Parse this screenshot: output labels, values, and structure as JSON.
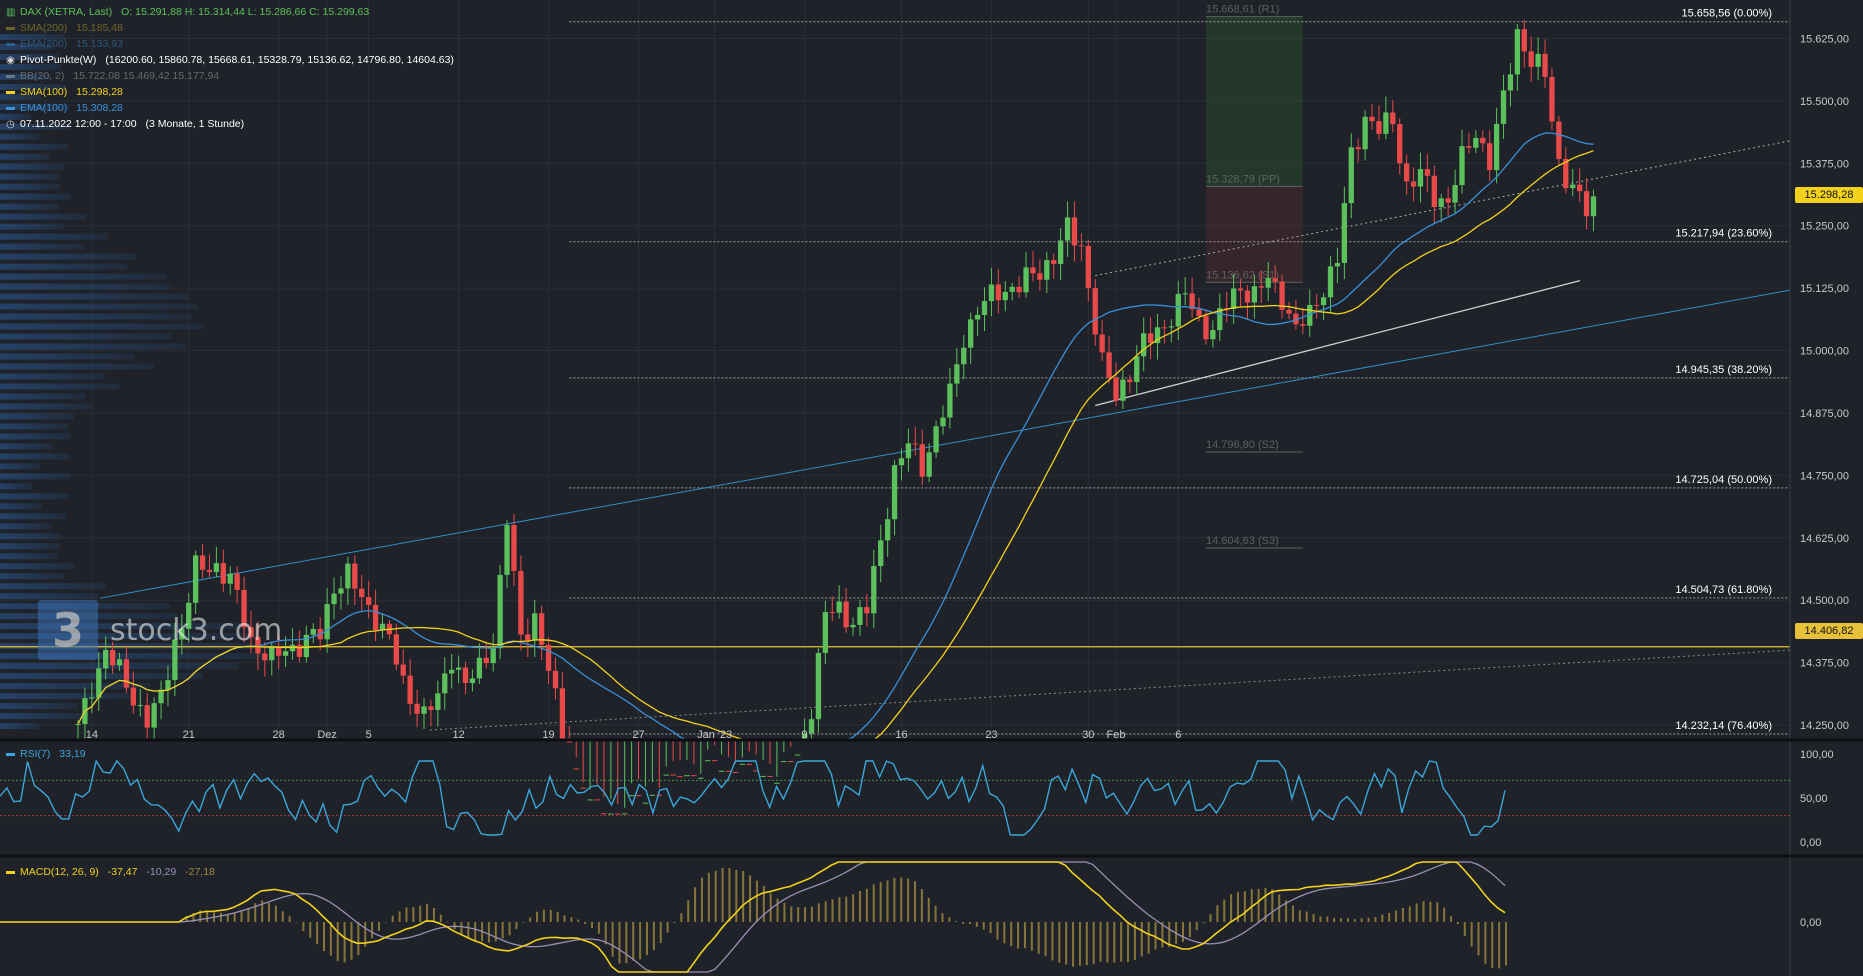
{
  "header": {
    "instrument": "DAX (XETRA, Last)",
    "ohlc": "O: 15.291,88   H: 15.314,44   L: 15.286,66   C: 15.299,63"
  },
  "legend": [
    {
      "label": "SMA(200)",
      "value": "15.185,48",
      "color": "#c9b22a",
      "dim": true,
      "kind": "line"
    },
    {
      "label": "EMA(200)",
      "value": "15.133,93",
      "color": "#3a8fd9",
      "dim": true,
      "kind": "line"
    },
    {
      "label": "Pivot-Punkte(W)",
      "value": "(16200.60,  15860.78,  15668.61,  15328.79,  15136.62,  14796.80,  14604.63)",
      "color": "#ffffff",
      "dim": false,
      "kind": "radio"
    },
    {
      "label": "BB(20, 2)",
      "value": "15.722,08  15.469,42  15.177,94",
      "color": "#bbbbbb",
      "dim": true,
      "kind": "line"
    },
    {
      "label": "SMA(100)",
      "value": "15.298,28",
      "color": "#f2d21b",
      "dim": false,
      "kind": "line"
    },
    {
      "label": "EMA(100)",
      "value": "15.308,28",
      "color": "#3a8fd9",
      "dim": false,
      "kind": "line"
    },
    {
      "label": "07.11.2022 12:00 - 17:00",
      "value": "(3 Monate, 1 Stunde)",
      "color": "#ffffff",
      "dim": false,
      "kind": "clock"
    }
  ],
  "logo_text": "stock3.com",
  "current_price_tag": "15.298,28",
  "horizontal_tag": "14.406,82",
  "colors": {
    "background": "#1f2329",
    "up_candle": "#5cc05c",
    "down_candle": "#e84a4a",
    "sma100": "#f2d21b",
    "ema100": "#3a8fd9",
    "trendline": "#2f8fc8",
    "macd_line": "#f2d21b",
    "signal_line": "#9a8fb5",
    "rsi_line": "#3aa6d9"
  },
  "chart_data": {
    "type": "candlestick",
    "title": "DAX (XETRA, Last)",
    "interval": "1 Stunde",
    "y_axis": {
      "ticks": [
        "15.625,00",
        "15.500,00",
        "15.375,00",
        "15.250,00",
        "15.125,00",
        "15.000,00",
        "14.875,00",
        "14.750,00",
        "14.625,00",
        "14.500,00",
        "14.375,00",
        "14.250,00"
      ],
      "ylim": [
        14220,
        15700
      ]
    },
    "x_axis": {
      "ticks": [
        "14",
        "21",
        "28",
        "Dez",
        "5",
        "12",
        "19",
        "27",
        "Jan '23",
        "9",
        "16",
        "23",
        "30",
        "Feb",
        "6"
      ]
    },
    "fibonacci": [
      {
        "label": "15.658,56 (0.00%)",
        "value": 15658.56
      },
      {
        "label": "15.217,94 (23.60%)",
        "value": 15217.94
      },
      {
        "label": "14.945,35 (38.20%)",
        "value": 14945.35
      },
      {
        "label": "14.725,04 (50.00%)",
        "value": 14725.04
      },
      {
        "label": "14.504,73 (61.80%)",
        "value": 14504.73
      },
      {
        "label": "14.232,14 (76.40%)",
        "value": 14232.14
      }
    ],
    "pivots": [
      {
        "label": "15.668,61 (R1)",
        "value": 15668.61
      },
      {
        "label": "15.328,79 (PP)",
        "value": 15328.79
      },
      {
        "label": "15.136,62 (S1)",
        "value": 15136.62
      },
      {
        "label": "14.796,80 (S2)",
        "value": 14796.8
      },
      {
        "label": "14.604,63 (S3)",
        "value": 14604.63
      }
    ],
    "horizontal_line": 14406.82,
    "last_close": 15299.63,
    "close_path": [
      [
        0,
        14240
      ],
      [
        2,
        14330
      ],
      [
        4,
        14400
      ],
      [
        7,
        14330
      ],
      [
        10,
        14260
      ],
      [
        12,
        14300
      ],
      [
        14,
        14420
      ],
      [
        15,
        14450
      ],
      [
        17,
        14560
      ],
      [
        20,
        14570
      ],
      [
        22,
        14540
      ],
      [
        25,
        14420
      ],
      [
        28,
        14380
      ],
      [
        30,
        14400
      ],
      [
        33,
        14420
      ],
      [
        35,
        14430
      ],
      [
        37,
        14530
      ],
      [
        39,
        14550
      ],
      [
        41,
        14500
      ],
      [
        43,
        14470
      ],
      [
        45,
        14420
      ],
      [
        47,
        14330
      ],
      [
        50,
        14270
      ],
      [
        52,
        14300
      ],
      [
        54,
        14390
      ],
      [
        56,
        14330
      ],
      [
        58,
        14360
      ],
      [
        60,
        14420
      ],
      [
        62,
        14660
      ],
      [
        64,
        14420
      ],
      [
        66,
        14470
      ],
      [
        68,
        14360
      ],
      [
        70,
        14230
      ],
      [
        72,
        14120
      ],
      [
        75,
        14060
      ],
      [
        80,
        14080
      ],
      [
        85,
        14130
      ],
      [
        90,
        14150
      ],
      [
        95,
        14160
      ],
      [
        100,
        14130
      ],
      [
        104,
        14180
      ],
      [
        106,
        14290
      ],
      [
        108,
        14470
      ],
      [
        110,
        14480
      ],
      [
        112,
        14460
      ],
      [
        114,
        14480
      ],
      [
        116,
        14620
      ],
      [
        118,
        14760
      ],
      [
        120,
        14810
      ],
      [
        122,
        14770
      ],
      [
        124,
        14840
      ],
      [
        126,
        14910
      ],
      [
        128,
        15030
      ],
      [
        130,
        15080
      ],
      [
        133,
        15120
      ],
      [
        136,
        15130
      ],
      [
        139,
        15160
      ],
      [
        141,
        15190
      ],
      [
        143,
        15240
      ],
      [
        145,
        15210
      ],
      [
        146,
        15130
      ],
      [
        148,
        14970
      ],
      [
        150,
        14910
      ],
      [
        152,
        14960
      ],
      [
        154,
        15010
      ],
      [
        156,
        15040
      ],
      [
        158,
        15070
      ],
      [
        160,
        15110
      ],
      [
        162,
        15060
      ],
      [
        164,
        15040
      ],
      [
        166,
        15090
      ],
      [
        168,
        15130
      ],
      [
        170,
        15110
      ],
      [
        172,
        15140
      ],
      [
        174,
        15110
      ],
      [
        176,
        15040
      ],
      [
        178,
        15070
      ],
      [
        180,
        15130
      ],
      [
        182,
        15180
      ],
      [
        184,
        15390
      ],
      [
        186,
        15470
      ],
      [
        188,
        15440
      ],
      [
        190,
        15460
      ],
      [
        192,
        15330
      ],
      [
        194,
        15350
      ],
      [
        196,
        15310
      ],
      [
        198,
        15300
      ],
      [
        200,
        15380
      ],
      [
        202,
        15440
      ],
      [
        204,
        15380
      ],
      [
        206,
        15500
      ],
      [
        208,
        15640
      ],
      [
        210,
        15580
      ],
      [
        212,
        15550
      ],
      [
        214,
        15380
      ],
      [
        216,
        15320
      ],
      [
        218,
        15280
      ],
      [
        219,
        15299.63
      ]
    ],
    "rsi": {
      "label": "RSI(7)",
      "value": "33,19",
      "ticks": [
        "100,00",
        "50,00",
        "0,00"
      ],
      "upper": 70,
      "lower": 30
    },
    "macd": {
      "label": "MACD(12, 26, 9)",
      "values": [
        "-37,47",
        "-10,29",
        "-27,18"
      ],
      "ticks": [
        "0,00"
      ]
    }
  }
}
